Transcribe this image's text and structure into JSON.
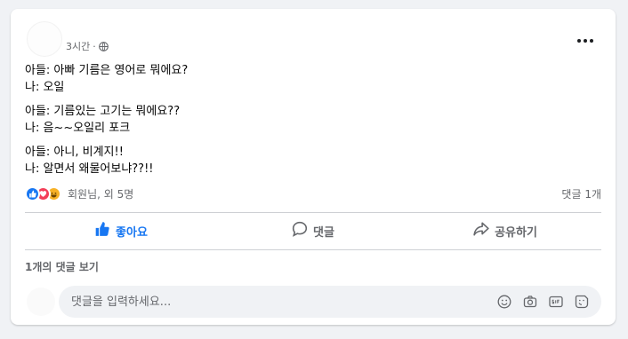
{
  "post": {
    "timestamp": "3시간",
    "privacy_icon": "globe-icon",
    "more_icon": "more-options-icon",
    "paragraphs": [
      [
        "아들: 아빠 기름은 영어로 뭐에요?",
        "나: 오일"
      ],
      [
        "아들: 기름있는 고기는 뭐에요??",
        "나: 음~~오일리 포크"
      ],
      [
        "아들: 아니, 비계지!!",
        "나: 알면서 왜물어보냐??!!"
      ]
    ]
  },
  "stats": {
    "reaction_icons": [
      "like-icon",
      "love-icon",
      "haha-icon"
    ],
    "names": "회원님, 외 5명",
    "comments_count": "댓글 1개"
  },
  "actions": {
    "like_label": "좋아요",
    "comment_label": "댓글",
    "share_label": "공유하기"
  },
  "comments": {
    "view_label": "1개의 댓글 보기",
    "input_placeholder": "댓글을 입력하세요...",
    "input_icons": [
      "emoji-icon",
      "camera-icon",
      "gif-icon",
      "sticker-icon"
    ]
  },
  "colors": {
    "accent": "#1877f2",
    "love": "#f33e58",
    "haha": "#f7b125",
    "secondary_text": "#65676b",
    "page_bg": "#f0f2f5"
  }
}
